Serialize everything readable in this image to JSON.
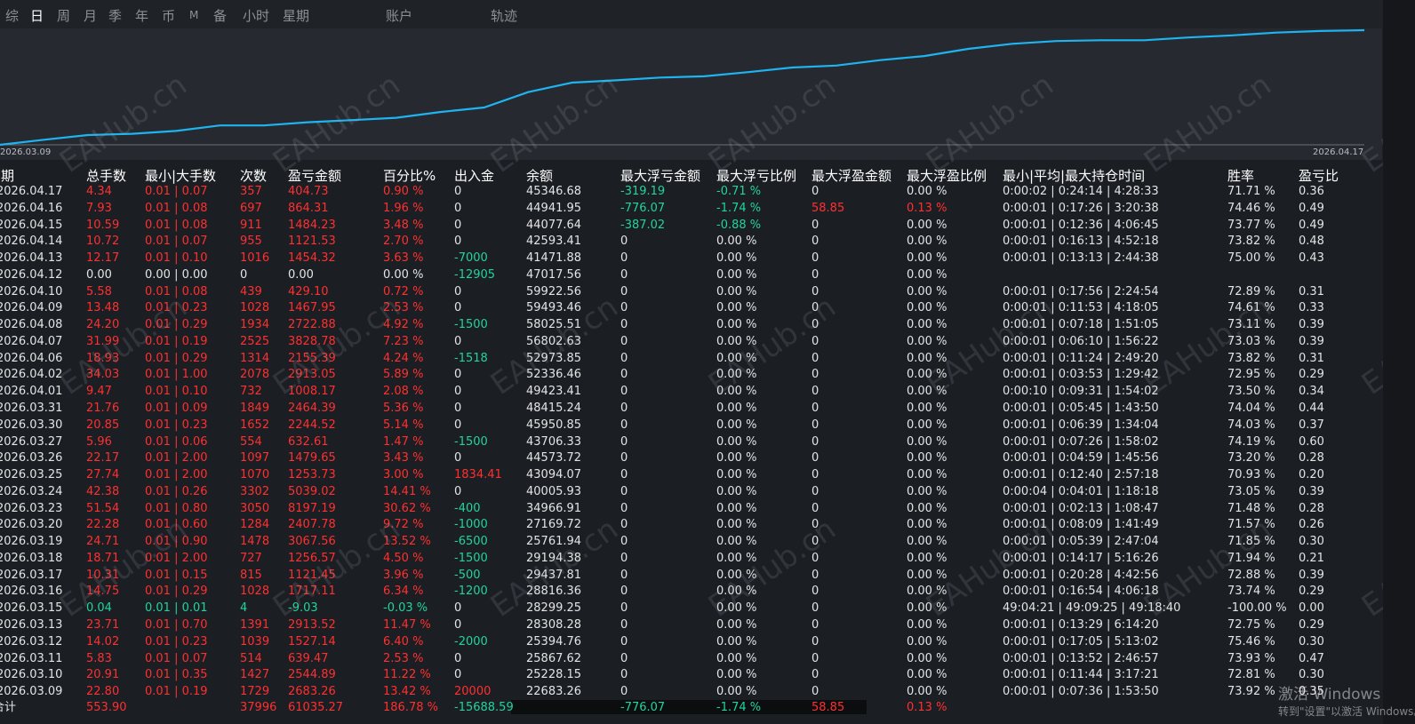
{
  "tabs": [
    "综",
    "日",
    "周",
    "月",
    "季",
    "年",
    "币",
    "M",
    "备",
    "小时",
    "星期",
    "账户",
    "轨迹"
  ],
  "active_tab": "日",
  "chart": {
    "start_date": "2026.03.09",
    "end_date": "2026.04.17",
    "line_color": "#1fb4f0",
    "balance_series": [
      22683.26,
      25228.15,
      25867.62,
      25394.76,
      28308.28,
      28299.25,
      28816.36,
      29437.81,
      29194.38,
      25761.94,
      27169.72,
      34966.91,
      40005.93,
      43094.07,
      44573.72,
      43706.33,
      45950.85,
      48415.24,
      49423.41,
      52336.46,
      52973.85,
      56802.63,
      58025.51,
      59493.46,
      59922.56,
      47017.56,
      41471.88,
      42593.41,
      44077.64,
      44941.95,
      45346.68
    ]
  },
  "watermark": "EAHub.cn",
  "columns": [
    "日期",
    "总手数",
    "最小|大手数",
    "次数",
    "盈亏金额",
    "百分比%",
    "出入金",
    "余额",
    "最大浮亏金额",
    "最大浮亏比例",
    "最大浮盈金额",
    "最大浮盈比例",
    "最小|平均|最大持仓时间",
    "胜率",
    "盈亏比"
  ],
  "rows": [
    {
      "date": "2026.04.17",
      "lots": "4.34",
      "minmax": "0.01 | 0.07",
      "trades": "357",
      "pl": "404.73",
      "pct": "0.90 %",
      "flow": "0",
      "balance": "45346.68",
      "maxdd": "-319.19",
      "maxddp": "-0.71 %",
      "maxfp": "0",
      "maxfpp": "0.00 %",
      "hold": "0:00:02 | 0:24:14 | 4:28:33",
      "win": "71.71 %",
      "rr": "0.36"
    },
    {
      "date": "2026.04.16",
      "lots": "7.93",
      "minmax": "0.01 | 0.08",
      "trades": "697",
      "pl": "864.31",
      "pct": "1.96 %",
      "flow": "0",
      "balance": "44941.95",
      "maxdd": "-776.07",
      "maxddp": "-1.74 %",
      "maxfp": "58.85",
      "maxfpp": "0.13 %",
      "hold": "0:00:01 | 0:17:26 | 3:20:38",
      "win": "74.46 %",
      "rr": "0.49"
    },
    {
      "date": "2026.04.15",
      "lots": "10.59",
      "minmax": "0.01 | 0.08",
      "trades": "911",
      "pl": "1484.23",
      "pct": "3.48 %",
      "flow": "0",
      "balance": "44077.64",
      "maxdd": "-387.02",
      "maxddp": "-0.88 %",
      "maxfp": "0",
      "maxfpp": "0.00 %",
      "hold": "0:00:01 | 0:12:36 | 4:06:45",
      "win": "73.77 %",
      "rr": "0.49"
    },
    {
      "date": "2026.04.14",
      "lots": "10.72",
      "minmax": "0.01 | 0.07",
      "trades": "955",
      "pl": "1121.53",
      "pct": "2.70 %",
      "flow": "0",
      "balance": "42593.41",
      "maxdd": "0",
      "maxddp": "0.00 %",
      "maxfp": "0",
      "maxfpp": "0.00 %",
      "hold": "0:00:01 | 0:16:13 | 4:52:18",
      "win": "73.82 %",
      "rr": "0.48"
    },
    {
      "date": "2026.04.13",
      "lots": "12.17",
      "minmax": "0.01 | 0.10",
      "trades": "1016",
      "pl": "1454.32",
      "pct": "3.63 %",
      "flow": "-7000",
      "balance": "41471.88",
      "maxdd": "0",
      "maxddp": "0.00 %",
      "maxfp": "0",
      "maxfpp": "0.00 %",
      "hold": "0:00:01 | 0:13:13 | 2:44:38",
      "win": "75.00 %",
      "rr": "0.43"
    },
    {
      "date": "2026.04.12",
      "lots": "0.00",
      "minmax": "0.00 | 0.00",
      "trades": "0",
      "pl": "0.00",
      "pct": "0.00 %",
      "flow": "-12905",
      "balance": "47017.56",
      "maxdd": "0",
      "maxddp": "0.00 %",
      "maxfp": "0",
      "maxfpp": "0.00 %",
      "hold": "",
      "win": "",
      "rr": ""
    },
    {
      "date": "2026.04.10",
      "lots": "5.58",
      "minmax": "0.01 | 0.08",
      "trades": "439",
      "pl": "429.10",
      "pct": "0.72 %",
      "flow": "0",
      "balance": "59922.56",
      "maxdd": "0",
      "maxddp": "0.00 %",
      "maxfp": "0",
      "maxfpp": "0.00 %",
      "hold": "0:00:01 | 0:17:56 | 2:24:54",
      "win": "72.89 %",
      "rr": "0.31"
    },
    {
      "date": "2026.04.09",
      "lots": "13.48",
      "minmax": "0.01 | 0.23",
      "trades": "1028",
      "pl": "1467.95",
      "pct": "2.53 %",
      "flow": "0",
      "balance": "59493.46",
      "maxdd": "0",
      "maxddp": "0.00 %",
      "maxfp": "0",
      "maxfpp": "0.00 %",
      "hold": "0:00:01 | 0:11:53 | 4:18:05",
      "win": "74.61 %",
      "rr": "0.33"
    },
    {
      "date": "2026.04.08",
      "lots": "24.20",
      "minmax": "0.01 | 0.29",
      "trades": "1934",
      "pl": "2722.88",
      "pct": "4.92 %",
      "flow": "-1500",
      "balance": "58025.51",
      "maxdd": "0",
      "maxddp": "0.00 %",
      "maxfp": "0",
      "maxfpp": "0.00 %",
      "hold": "0:00:01 | 0:07:18 | 1:51:05",
      "win": "73.11 %",
      "rr": "0.39"
    },
    {
      "date": "2026.04.07",
      "lots": "31.99",
      "minmax": "0.01 | 0.19",
      "trades": "2525",
      "pl": "3828.78",
      "pct": "7.23 %",
      "flow": "0",
      "balance": "56802.63",
      "maxdd": "0",
      "maxddp": "0.00 %",
      "maxfp": "0",
      "maxfpp": "0.00 %",
      "hold": "0:00:01 | 0:06:10 | 1:56:22",
      "win": "73.03 %",
      "rr": "0.39"
    },
    {
      "date": "2026.04.06",
      "lots": "18.93",
      "minmax": "0.01 | 0.29",
      "trades": "1314",
      "pl": "2155.39",
      "pct": "4.24 %",
      "flow": "-1518",
      "balance": "52973.85",
      "maxdd": "0",
      "maxddp": "0.00 %",
      "maxfp": "0",
      "maxfpp": "0.00 %",
      "hold": "0:00:01 | 0:11:24 | 2:49:20",
      "win": "73.82 %",
      "rr": "0.31"
    },
    {
      "date": "2026.04.02",
      "lots": "34.03",
      "minmax": "0.01 | 1.00",
      "trades": "2078",
      "pl": "2913.05",
      "pct": "5.89 %",
      "flow": "0",
      "balance": "52336.46",
      "maxdd": "0",
      "maxddp": "0.00 %",
      "maxfp": "0",
      "maxfpp": "0.00 %",
      "hold": "0:00:01 | 0:03:53 | 1:29:42",
      "win": "72.95 %",
      "rr": "0.29"
    },
    {
      "date": "2026.04.01",
      "lots": "9.47",
      "minmax": "0.01 | 0.10",
      "trades": "732",
      "pl": "1008.17",
      "pct": "2.08 %",
      "flow": "0",
      "balance": "49423.41",
      "maxdd": "0",
      "maxddp": "0.00 %",
      "maxfp": "0",
      "maxfpp": "0.00 %",
      "hold": "0:00:10 | 0:09:31 | 1:54:02",
      "win": "73.50 %",
      "rr": "0.34"
    },
    {
      "date": "2026.03.31",
      "lots": "21.76",
      "minmax": "0.01 | 0.09",
      "trades": "1849",
      "pl": "2464.39",
      "pct": "5.36 %",
      "flow": "0",
      "balance": "48415.24",
      "maxdd": "0",
      "maxddp": "0.00 %",
      "maxfp": "0",
      "maxfpp": "0.00 %",
      "hold": "0:00:01 | 0:05:45 | 1:43:50",
      "win": "74.04 %",
      "rr": "0.44"
    },
    {
      "date": "2026.03.30",
      "lots": "20.85",
      "minmax": "0.01 | 0.23",
      "trades": "1652",
      "pl": "2244.52",
      "pct": "5.14 %",
      "flow": "0",
      "balance": "45950.85",
      "maxdd": "0",
      "maxddp": "0.00 %",
      "maxfp": "0",
      "maxfpp": "0.00 %",
      "hold": "0:00:01 | 0:06:39 | 1:34:04",
      "win": "74.03 %",
      "rr": "0.37"
    },
    {
      "date": "2026.03.27",
      "lots": "5.96",
      "minmax": "0.01 | 0.06",
      "trades": "554",
      "pl": "632.61",
      "pct": "1.47 %",
      "flow": "-1500",
      "balance": "43706.33",
      "maxdd": "0",
      "maxddp": "0.00 %",
      "maxfp": "0",
      "maxfpp": "0.00 %",
      "hold": "0:00:01 | 0:07:26 | 1:58:02",
      "win": "74.19 %",
      "rr": "0.60"
    },
    {
      "date": "2026.03.26",
      "lots": "22.17",
      "minmax": "0.01 | 2.00",
      "trades": "1097",
      "pl": "1479.65",
      "pct": "3.43 %",
      "flow": "0",
      "balance": "44573.72",
      "maxdd": "0",
      "maxddp": "0.00 %",
      "maxfp": "0",
      "maxfpp": "0.00 %",
      "hold": "0:00:01 | 0:04:59 | 1:45:56",
      "win": "73.20 %",
      "rr": "0.28"
    },
    {
      "date": "2026.03.25",
      "lots": "27.74",
      "minmax": "0.01 | 2.00",
      "trades": "1070",
      "pl": "1253.73",
      "pct": "3.00 %",
      "flow": "1834.41",
      "balance": "43094.07",
      "maxdd": "0",
      "maxddp": "0.00 %",
      "maxfp": "0",
      "maxfpp": "0.00 %",
      "hold": "0:00:01 | 0:12:40 | 2:57:18",
      "win": "70.93 %",
      "rr": "0.20"
    },
    {
      "date": "2026.03.24",
      "lots": "42.38",
      "minmax": "0.01 | 0.26",
      "trades": "3302",
      "pl": "5039.02",
      "pct": "14.41 %",
      "flow": "0",
      "balance": "40005.93",
      "maxdd": "0",
      "maxddp": "0.00 %",
      "maxfp": "0",
      "maxfpp": "0.00 %",
      "hold": "0:00:04 | 0:04:01 | 1:18:18",
      "win": "73.05 %",
      "rr": "0.39"
    },
    {
      "date": "2026.03.23",
      "lots": "51.54",
      "minmax": "0.01 | 0.80",
      "trades": "3050",
      "pl": "8197.19",
      "pct": "30.62 %",
      "flow": "-400",
      "balance": "34966.91",
      "maxdd": "0",
      "maxddp": "0.00 %",
      "maxfp": "0",
      "maxfpp": "0.00 %",
      "hold": "0:00:01 | 0:02:13 | 1:08:47",
      "win": "71.48 %",
      "rr": "0.28"
    },
    {
      "date": "2026.03.20",
      "lots": "22.28",
      "minmax": "0.01 | 0.60",
      "trades": "1284",
      "pl": "2407.78",
      "pct": "9.72 %",
      "flow": "-1000",
      "balance": "27169.72",
      "maxdd": "0",
      "maxddp": "0.00 %",
      "maxfp": "0",
      "maxfpp": "0.00 %",
      "hold": "0:00:01 | 0:08:09 | 1:41:49",
      "win": "71.57 %",
      "rr": "0.26"
    },
    {
      "date": "2026.03.19",
      "lots": "24.71",
      "minmax": "0.01 | 0.90",
      "trades": "1478",
      "pl": "3067.56",
      "pct": "13.52 %",
      "flow": "-6500",
      "balance": "25761.94",
      "maxdd": "0",
      "maxddp": "0.00 %",
      "maxfp": "0",
      "maxfpp": "0.00 %",
      "hold": "0:00:01 | 0:05:39 | 2:47:04",
      "win": "71.85 %",
      "rr": "0.30"
    },
    {
      "date": "2026.03.18",
      "lots": "18.71",
      "minmax": "0.01 | 2.00",
      "trades": "727",
      "pl": "1256.57",
      "pct": "4.50 %",
      "flow": "-1500",
      "balance": "29194.38",
      "maxdd": "0",
      "maxddp": "0.00 %",
      "maxfp": "0",
      "maxfpp": "0.00 %",
      "hold": "0:00:01 | 0:14:17 | 5:16:26",
      "win": "71.94 %",
      "rr": "0.21"
    },
    {
      "date": "2026.03.17",
      "lots": "10.31",
      "minmax": "0.01 | 0.15",
      "trades": "815",
      "pl": "1121.45",
      "pct": "3.96 %",
      "flow": "-500",
      "balance": "29437.81",
      "maxdd": "0",
      "maxddp": "0.00 %",
      "maxfp": "0",
      "maxfpp": "0.00 %",
      "hold": "0:00:01 | 0:20:28 | 4:42:56",
      "win": "72.88 %",
      "rr": "0.39"
    },
    {
      "date": "2026.03.16",
      "lots": "14.75",
      "minmax": "0.01 | 0.29",
      "trades": "1028",
      "pl": "1717.11",
      "pct": "6.34 %",
      "flow": "-1200",
      "balance": "28816.36",
      "maxdd": "0",
      "maxddp": "0.00 %",
      "maxfp": "0",
      "maxfpp": "0.00 %",
      "hold": "0:00:01 | 0:16:54 | 4:06:18",
      "win": "73.74 %",
      "rr": "0.29"
    },
    {
      "date": "2026.03.15",
      "lots": "0.04",
      "minmax": "0.01 | 0.01",
      "trades": "4",
      "pl": "-9.03",
      "pct": "-0.03 %",
      "flow": "0",
      "balance": "28299.25",
      "maxdd": "0",
      "maxddp": "0.00 %",
      "maxfp": "0",
      "maxfpp": "0.00 %",
      "hold": "49:04:21 | 49:09:25 | 49:18:40",
      "win": "-100.00 %",
      "rr": "0.00"
    },
    {
      "date": "2026.03.13",
      "lots": "23.71",
      "minmax": "0.01 | 0.70",
      "trades": "1391",
      "pl": "2913.52",
      "pct": "11.47 %",
      "flow": "0",
      "balance": "28308.28",
      "maxdd": "0",
      "maxddp": "0.00 %",
      "maxfp": "0",
      "maxfpp": "0.00 %",
      "hold": "0:00:01 | 0:13:29 | 6:14:20",
      "win": "72.75 %",
      "rr": "0.29"
    },
    {
      "date": "2026.03.12",
      "lots": "14.02",
      "minmax": "0.01 | 0.23",
      "trades": "1039",
      "pl": "1527.14",
      "pct": "6.40 %",
      "flow": "-2000",
      "balance": "25394.76",
      "maxdd": "0",
      "maxddp": "0.00 %",
      "maxfp": "0",
      "maxfpp": "0.00 %",
      "hold": "0:00:01 | 0:17:05 | 5:13:02",
      "win": "75.46 %",
      "rr": "0.30"
    },
    {
      "date": "2026.03.11",
      "lots": "5.83",
      "minmax": "0.01 | 0.07",
      "trades": "514",
      "pl": "639.47",
      "pct": "2.53 %",
      "flow": "0",
      "balance": "25867.62",
      "maxdd": "0",
      "maxddp": "0.00 %",
      "maxfp": "0",
      "maxfpp": "0.00 %",
      "hold": "0:00:01 | 0:13:52 | 2:46:57",
      "win": "73.93 %",
      "rr": "0.47"
    },
    {
      "date": "2026.03.10",
      "lots": "20.91",
      "minmax": "0.01 | 0.35",
      "trades": "1427",
      "pl": "2544.89",
      "pct": "11.22 %",
      "flow": "0",
      "balance": "25228.15",
      "maxdd": "0",
      "maxddp": "0.00 %",
      "maxfp": "0",
      "maxfpp": "0.00 %",
      "hold": "0:00:01 | 0:11:44 | 3:17:21",
      "win": "72.81 %",
      "rr": "0.30"
    },
    {
      "date": "2026.03.09",
      "lots": "22.80",
      "minmax": "0.01 | 0.19",
      "trades": "1729",
      "pl": "2683.26",
      "pct": "13.42 %",
      "flow": "20000",
      "balance": "22683.26",
      "maxdd": "0",
      "maxddp": "0.00 %",
      "maxfp": "0",
      "maxfpp": "0.00 %",
      "hold": "0:00:01 | 0:07:36 | 1:53:50",
      "win": "73.92 %",
      "rr": "0.35"
    }
  ],
  "totals": {
    "label": "合计",
    "lots": "553.90",
    "trades": "37996",
    "pl": "61035.27",
    "pct": "186.78 %",
    "flow": "-15688.59",
    "maxdd": "-776.07",
    "maxddp": "-1.74 %",
    "maxfp": "58.85",
    "maxfpp": "0.13 %"
  },
  "windows_activation": {
    "title": "激活 Windows",
    "subtitle": "转到\"设置\"以激活 Windows。"
  },
  "colors": {
    "positive": "#ff3030",
    "negative": "#22d3a0",
    "neutral": "#e4e4e4",
    "line": "#1fb4f0"
  }
}
